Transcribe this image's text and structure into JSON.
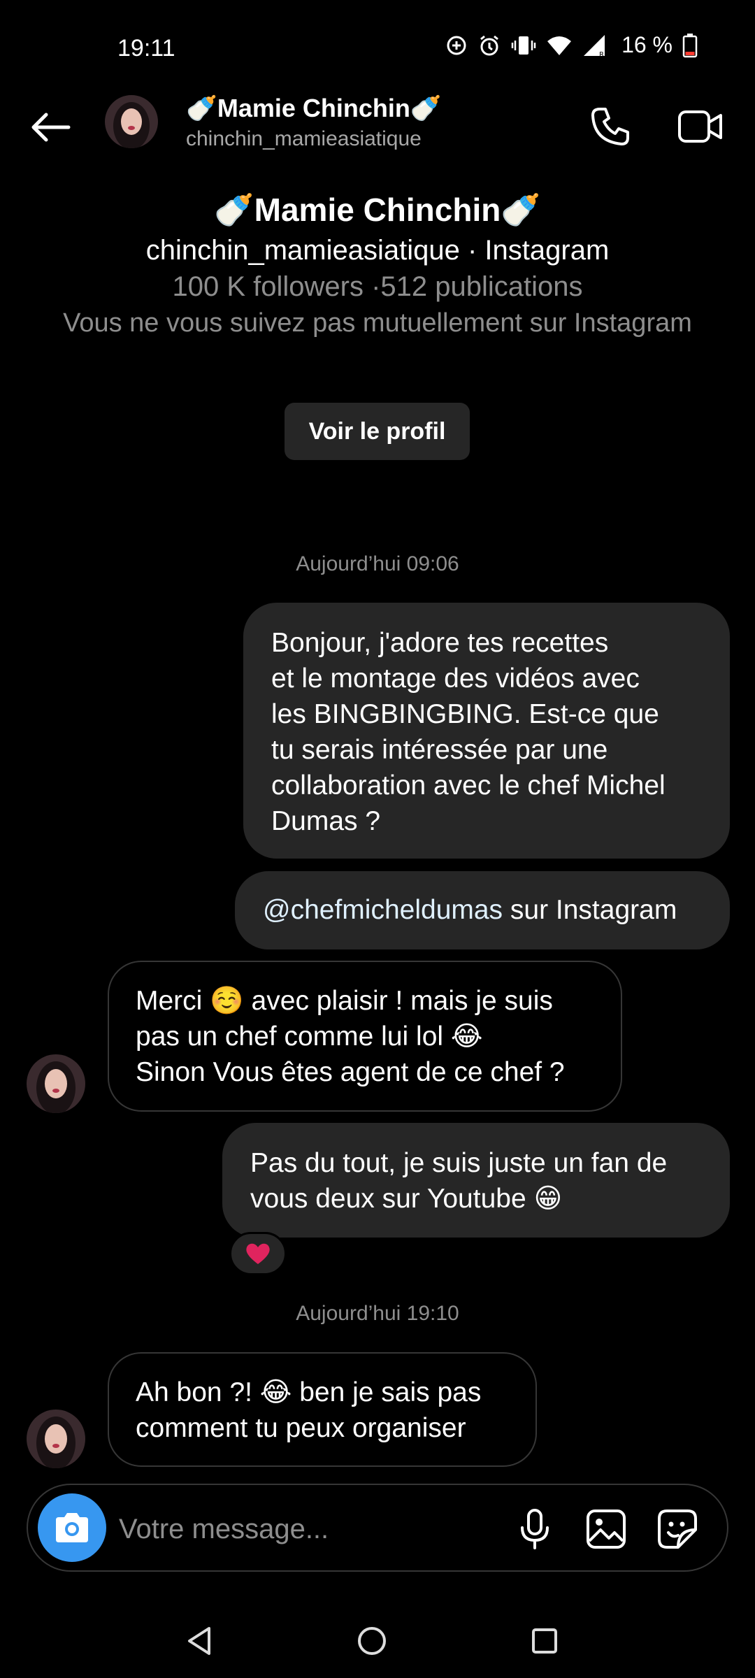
{
  "status_bar": {
    "time": "19:11",
    "battery": "16 %",
    "icons": [
      "data-saver-icon",
      "alarm-icon",
      "vibrate-icon",
      "wifi-icon",
      "signal-icon",
      "battery-icon"
    ]
  },
  "header": {
    "name": "🍼Mamie Chinchin🍼",
    "handle": "chinchin_mamieasiatique"
  },
  "profile": {
    "name": "🍼Mamie Chinchin🍼",
    "subtitle": "chinchin_mamieasiatique · Instagram",
    "stats": "100 K followers ·512 publications",
    "mutual": "Vous ne vous suivez pas mutuellement sur Instagram",
    "view_button": "Voir le profil"
  },
  "conversation": {
    "timestamp_1": "Aujourd’hui 09:06",
    "timestamp_2": "Aujourd’hui 19:10",
    "messages": [
      {
        "direction": "sent",
        "lines": [
          "Bonjour, j'adore tes recettes",
          "et le montage des vidéos avec",
          "les BINGBINGBING. Est-ce que",
          "tu serais intéressée par une",
          "collaboration avec le chef Michel",
          "Dumas ?"
        ]
      },
      {
        "direction": "sent",
        "mention": "@chefmicheldumas",
        "suffix": " sur Instagram"
      },
      {
        "direction": "received",
        "lines": [
          "Merci ☺️ avec plaisir ! mais je suis",
          "pas un chef comme lui lol 😂",
          "Sinon Vous êtes agent de ce chef ?"
        ]
      },
      {
        "direction": "sent",
        "lines": [
          "Pas du tout, je suis juste un fan de",
          "vous deux sur Youtube 😁"
        ],
        "reaction": "❤️"
      },
      {
        "direction": "received",
        "lines": [
          "Ah bon ?! 😂 ben je sais pas",
          "comment tu peux organiser"
        ]
      }
    ]
  },
  "composer": {
    "placeholder": "Votre message..."
  },
  "colors": {
    "background": "#000000",
    "sent_bubble": "#262626",
    "received_border": "#363636",
    "muted_text": "#8e8e8e",
    "camera_button": "#3797f0",
    "heart": "#e0245e"
  }
}
